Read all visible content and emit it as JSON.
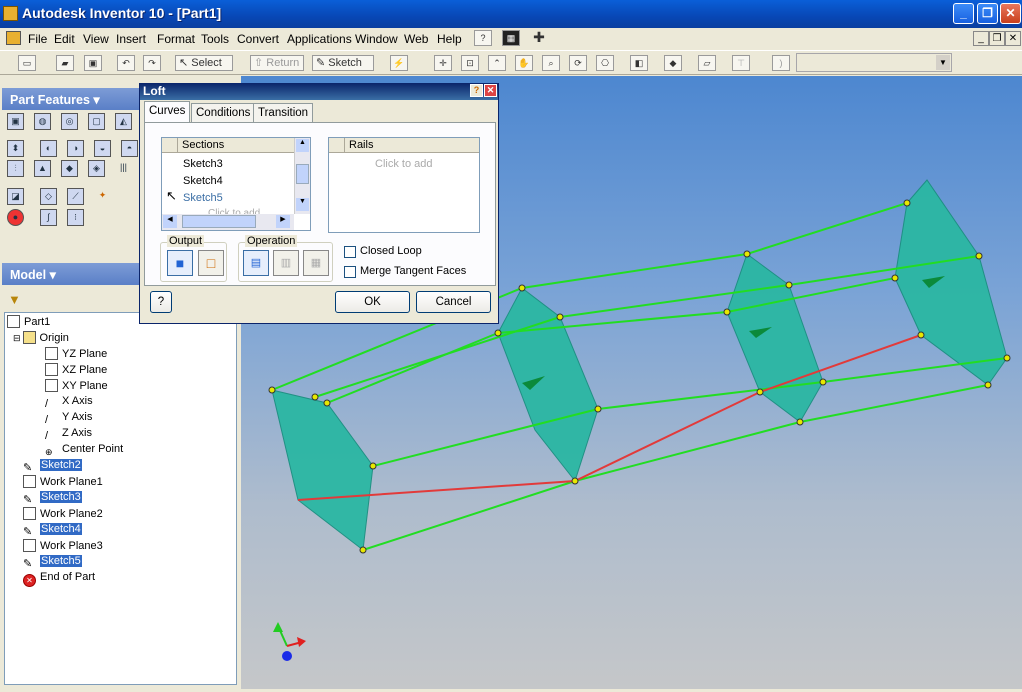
{
  "window": {
    "title": "Autodesk Inventor 10 - [Part1]",
    "min": "_",
    "max": "❐",
    "close": "✕"
  },
  "menu": [
    "File",
    "Edit",
    "View",
    "Insert",
    "Format",
    "Tools",
    "Convert",
    "Applications",
    "Window",
    "Web",
    "Help"
  ],
  "toolbar": {
    "select": "Select",
    "return": "Return",
    "sketch": "Sketch"
  },
  "panel": {
    "title": "Part Features ▾"
  },
  "model": {
    "title": "Model ▾",
    "filter_icon": "funnel-icon"
  },
  "tree": [
    {
      "label": "Part1",
      "selected": false
    },
    {
      "label": "Origin",
      "selected": false
    },
    {
      "label": "YZ Plane",
      "selected": false
    },
    {
      "label": "XZ Plane",
      "selected": false
    },
    {
      "label": "XY Plane",
      "selected": false
    },
    {
      "label": "X Axis",
      "selected": false
    },
    {
      "label": "Y Axis",
      "selected": false
    },
    {
      "label": "Z Axis",
      "selected": false
    },
    {
      "label": "Center Point",
      "selected": false
    },
    {
      "label": "Sketch2",
      "selected": true
    },
    {
      "label": "Work Plane1",
      "selected": false
    },
    {
      "label": "Sketch3",
      "selected": true
    },
    {
      "label": "Work Plane2",
      "selected": false
    },
    {
      "label": "Sketch4",
      "selected": true
    },
    {
      "label": "Work Plane3",
      "selected": false
    },
    {
      "label": "Sketch5",
      "selected": true
    },
    {
      "label": "End of Part",
      "selected": false
    }
  ],
  "loft": {
    "title": "Loft",
    "tabs": [
      "Curves",
      "Conditions",
      "Transition"
    ],
    "sections_header": "Sections",
    "sections": [
      "Sketch3",
      "Sketch4",
      "Sketch5"
    ],
    "sections_partial": "Click to add",
    "rails_header": "Rails",
    "rails_placeholder": "Click to add",
    "output_label": "Output",
    "operation_label": "Operation",
    "closed_loop": "Closed Loop",
    "merge_tangent": "Merge Tangent Faces",
    "ok": "OK",
    "cancel": "Cancel",
    "help": "?"
  },
  "colors": {
    "section": "#2bb7a3",
    "rail": "#22dd22",
    "spine": "#e23a3a",
    "selection": "#316ac5"
  }
}
